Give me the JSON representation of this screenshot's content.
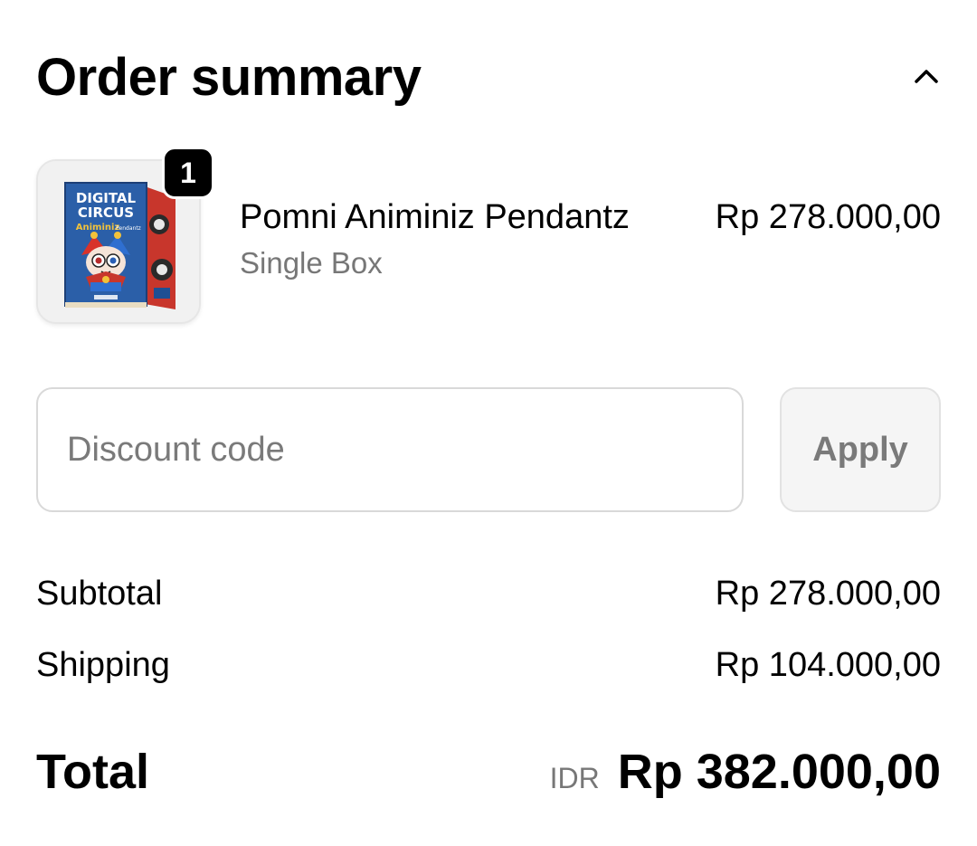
{
  "header": {
    "title": "Order summary",
    "collapse_icon": "chevron-up-icon"
  },
  "item": {
    "quantity": "1",
    "name": "Pomni Animiniz Pendantz",
    "variant": "Single Box",
    "price": "Rp 278.000,00",
    "image_text": {
      "line1": "DIGITAL",
      "line2": "CIRCUS",
      "line3": "Animiniz",
      "line4": "Pendantz"
    }
  },
  "discount": {
    "placeholder": "Discount code",
    "value": "",
    "apply_label": "Apply"
  },
  "summary": {
    "subtotal_label": "Subtotal",
    "subtotal_value": "Rp 278.000,00",
    "shipping_label": "Shipping",
    "shipping_value": "Rp 104.000,00"
  },
  "total": {
    "label": "Total",
    "currency": "IDR",
    "amount": "Rp 382.000,00"
  },
  "colors": {
    "text_primary": "#000000",
    "text_muted": "#777777",
    "border": "#d9d9d9",
    "apply_bg": "#f5f5f5",
    "badge_bg": "#000000",
    "box_blue": "#2b5fa8",
    "box_red": "#c8362c"
  }
}
